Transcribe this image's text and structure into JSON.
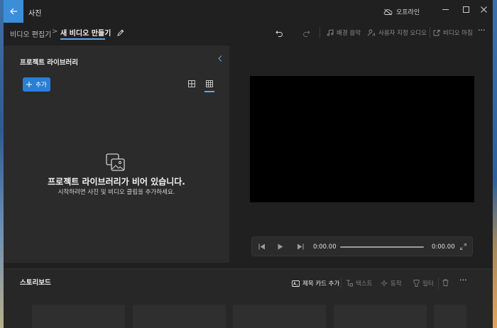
{
  "app": {
    "title": "사진",
    "status": "오프라인"
  },
  "breadcrumb": {
    "parent": "비디오 편집기",
    "separator": ">",
    "current": "새 비디오 만들기"
  },
  "toolbar": {
    "actions": [
      {
        "label": "배경 음악",
        "icon": "music-note-icon"
      },
      {
        "label": "사용자 지정 오디오",
        "icon": "custom-audio-icon"
      },
      {
        "label": "비디오 마침",
        "icon": "share-export-icon"
      }
    ],
    "more": "···"
  },
  "library": {
    "title": "프로젝트 라이브러리",
    "add_label": "추가",
    "empty_title": "프로젝트 라이브러리가 비어 있습니다.",
    "empty_subtitle": "시작하려면 사진 및 비디오 클립을 추가하세요."
  },
  "player": {
    "current_time": "0:00.00",
    "total_time": "0:00.00"
  },
  "storyboard": {
    "title": "스토리보드",
    "actions": [
      {
        "label": "제목 카드 추가",
        "enabled": true
      },
      {
        "label": "텍스트",
        "enabled": false
      },
      {
        "label": "동작",
        "enabled": false
      },
      {
        "label": "필터",
        "enabled": false
      }
    ],
    "more": "···"
  },
  "colors": {
    "accent": "#2a7fd4",
    "titlebar_back": "#3a8fd8",
    "background": "#202020",
    "panel": "#2b2b2b"
  }
}
